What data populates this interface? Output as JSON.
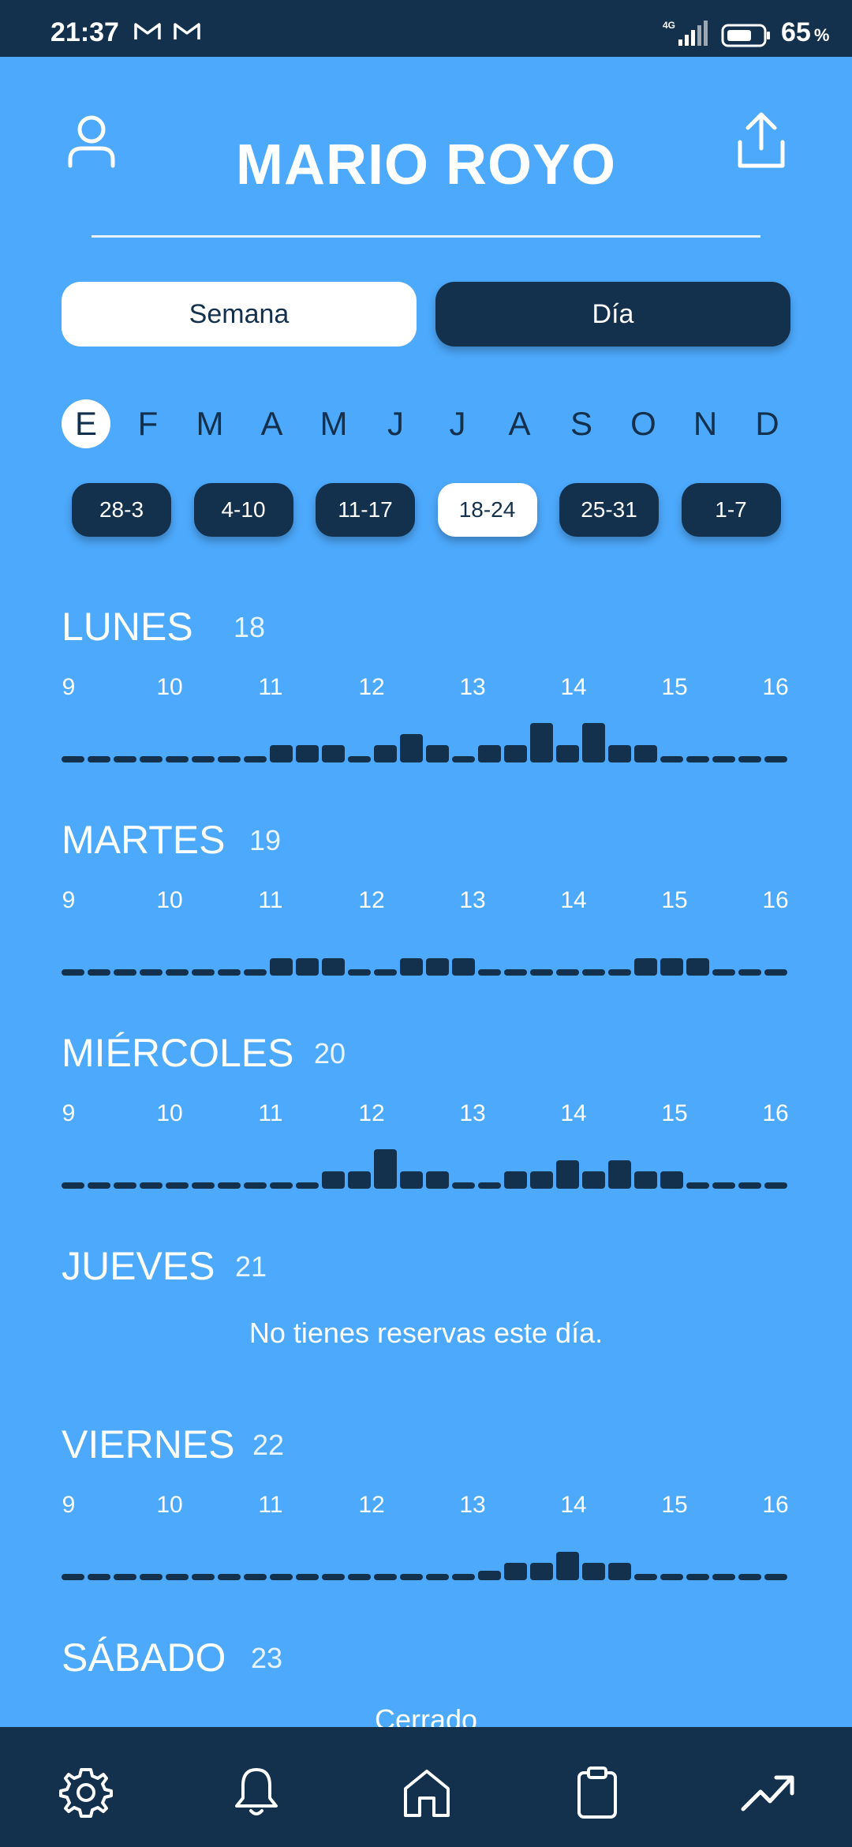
{
  "status": {
    "time": "21:37",
    "network": "4G",
    "battery_pct": "65",
    "battery_unit": "%",
    "notification_icons": [
      "gmail-icon",
      "gmail-icon"
    ]
  },
  "header": {
    "title": "MARIO ROYO",
    "profile_icon": "person-icon",
    "share_icon": "share-icon"
  },
  "view_toggle": {
    "week_label": "Semana",
    "day_label": "Día",
    "selected": "Semana"
  },
  "months": {
    "items": [
      "E",
      "F",
      "M",
      "A",
      "M",
      "J",
      "J",
      "A",
      "S",
      "O",
      "N",
      "D"
    ],
    "selected_index": 0
  },
  "weeks": {
    "items": [
      "28-3",
      "4-10",
      "11-17",
      "18-24",
      "25-31",
      "1-7"
    ],
    "selected_index": 3
  },
  "hour_labels": [
    "9",
    "10",
    "11",
    "12",
    "13",
    "14",
    "15",
    "16"
  ],
  "days": [
    {
      "name": "LUNES",
      "number": "18",
      "occupancy": [
        0,
        0,
        0,
        0,
        0,
        0,
        0,
        0,
        1,
        1,
        1,
        0,
        1,
        2,
        1,
        0,
        1,
        1,
        3,
        1,
        3,
        1,
        1,
        0,
        0,
        0,
        0,
        0
      ]
    },
    {
      "name": "MARTES",
      "number": "19",
      "occupancy": [
        0,
        0,
        0,
        0,
        0,
        0,
        0,
        0,
        1,
        1,
        1,
        0,
        0,
        1,
        1,
        1,
        0,
        0,
        0,
        0,
        0,
        0,
        1,
        1,
        1,
        0,
        0,
        0
      ]
    },
    {
      "name": "MIÉRCOLES",
      "number": "20",
      "occupancy": [
        0,
        0,
        0,
        0,
        0,
        0,
        0,
        0,
        0,
        0,
        1,
        1,
        3,
        1,
        1,
        0,
        0,
        1,
        1,
        2,
        1,
        2,
        1,
        1,
        0,
        0,
        0,
        0
      ]
    },
    {
      "name": "JUEVES",
      "number": "21",
      "message": "No tienes reservas este día."
    },
    {
      "name": "VIERNES",
      "number": "22",
      "occupancy": [
        0,
        0,
        0,
        0,
        0,
        0,
        0,
        0,
        0,
        0,
        0,
        0,
        0,
        0,
        0,
        0,
        0.3,
        1,
        1,
        2,
        1,
        1,
        0,
        0,
        0,
        0,
        0,
        0
      ]
    },
    {
      "name": "SÁBADO",
      "number": "23",
      "message": "Cerrado"
    }
  ],
  "nav": {
    "items": [
      "settings-icon",
      "bell-icon",
      "home-icon",
      "clipboard-icon",
      "trending-up-icon"
    ]
  }
}
